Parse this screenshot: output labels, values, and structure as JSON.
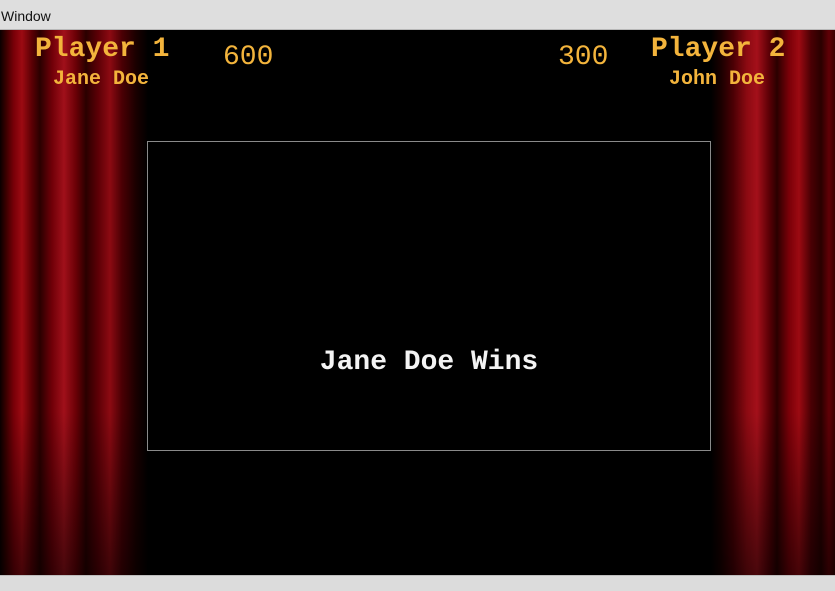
{
  "window": {
    "title": "Window"
  },
  "players": {
    "left": {
      "label": "Player 1",
      "name": "Jane Doe",
      "score": "600"
    },
    "right": {
      "label": "Player 2",
      "name": "John Doe",
      "score": "300"
    }
  },
  "board": {
    "message": "Jane Doe Wins"
  },
  "colors": {
    "hud_text": "#f3b43c",
    "board_text": "#f4f4f4",
    "background": "#000000",
    "curtain": "#8c0a12"
  }
}
